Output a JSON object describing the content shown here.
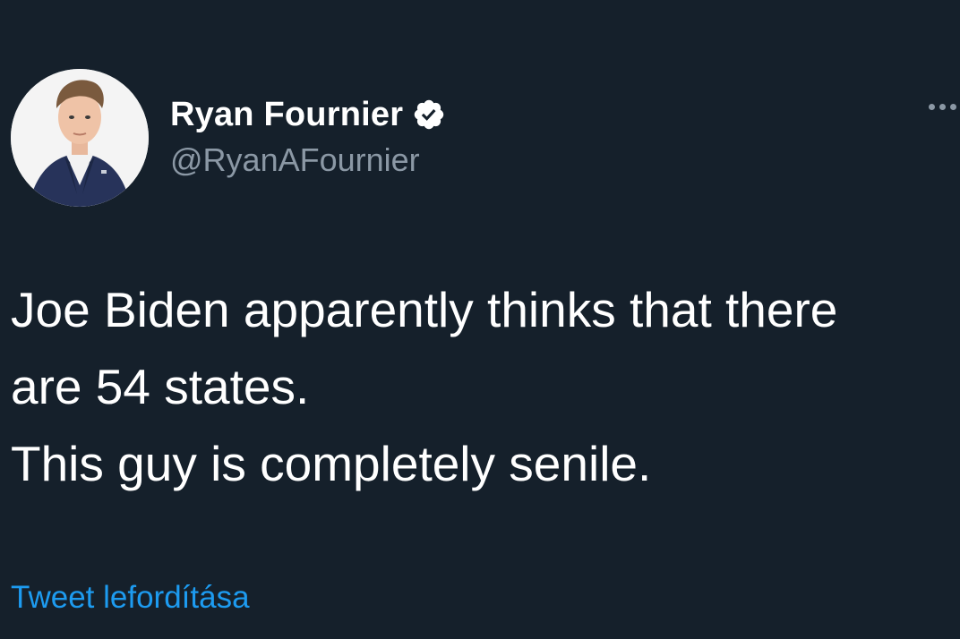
{
  "author": {
    "display_name": "Ryan Fournier",
    "handle": "@RyanAFournier",
    "verified": true
  },
  "icons": {
    "verified": "verified-badge-icon",
    "more": "more-options-icon"
  },
  "tweet": {
    "line_1": "Joe Biden apparently thinks that there",
    "line_2": "are 54 states.",
    "line_3": "This guy is completely senile."
  },
  "translate_link": "Tweet lefordítása",
  "colors": {
    "background": "#15202b",
    "text": "#ffffff",
    "secondary": "#8b98a5",
    "link": "#1d9bf0"
  }
}
